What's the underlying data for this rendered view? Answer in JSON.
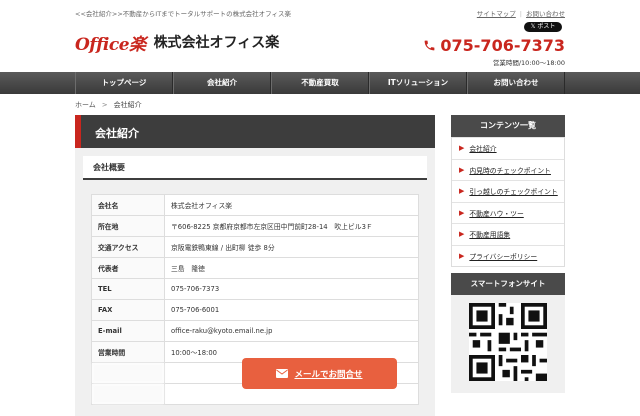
{
  "topbar": {
    "tagline": "<<会社紹介>>不動産からITまでトータルサポートの株式会社オフィス楽",
    "links": [
      "サイトマップ",
      "お問い合わせ"
    ],
    "post_button": "ポスト"
  },
  "header": {
    "logo_mark": "Office楽",
    "company_name": "株式会社オフィス楽",
    "phone": "075-706-7373",
    "hours": "営業時間/10:00～18:00"
  },
  "nav": {
    "items": [
      "トップページ",
      "会社紹介",
      "不動産買取",
      "ITソリューション",
      "お問い合わせ"
    ]
  },
  "breadcrumb": {
    "home": "ホーム",
    "separator": ">",
    "current": "会社紹介"
  },
  "main": {
    "page_title": "会社紹介",
    "section_title": "会社概要",
    "rows": [
      {
        "key": "会社名",
        "value": "株式会社オフィス楽"
      },
      {
        "key": "所在地",
        "value": "〒606-8225 京都府京都市左京区田中門前町28-14　吹上ビル3Ｆ"
      },
      {
        "key": "交通アクセス",
        "value": "京阪電鉄鴨東線 / 出町柳 徒歩 8分"
      },
      {
        "key": "代表者",
        "value": "三島　隆徳"
      },
      {
        "key": "TEL",
        "value": "075-706-7373"
      },
      {
        "key": "FAX",
        "value": "075-706-6001"
      },
      {
        "key": "E-mail",
        "value": "office-raku@kyoto.email.ne.jp"
      },
      {
        "key": "営業時間",
        "value": "10:00～18:00"
      }
    ]
  },
  "sidebar": {
    "title": "コンテンツ一覧",
    "items": [
      "会社紹介",
      "内見時のチェックポイント",
      "引っ越しのチェックポイント",
      "不動産ハウ・ツー",
      "不動産用語集",
      "プライバシーポリシー"
    ],
    "smartphone_title": "スマートフォンサイト"
  },
  "mail_button": {
    "label": "メールでお問合せ"
  },
  "colors": {
    "accent": "#c9261e",
    "mail": "#e8603f",
    "dark": "#3d3d3d"
  }
}
